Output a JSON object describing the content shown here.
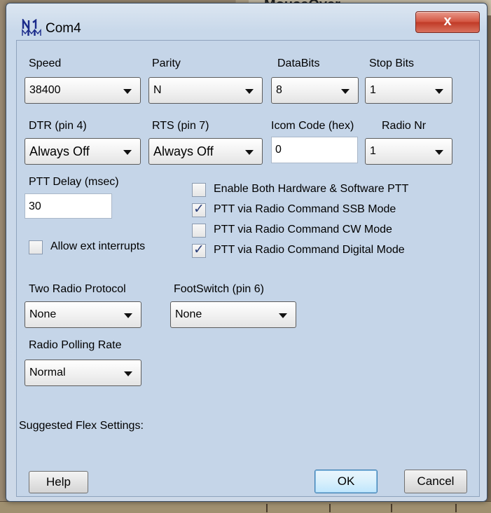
{
  "background": {
    "window_caption": "MouseOver"
  },
  "dialog": {
    "title": "Com4",
    "close_glyph": "x"
  },
  "labels": {
    "speed": "Speed",
    "parity": "Parity",
    "databits": "DataBits",
    "stopbits": "Stop Bits",
    "dtr": "DTR (pin 4)",
    "rts": "RTS (pin 7)",
    "icom": "Icom Code (hex)",
    "radio_nr": "Radio Nr",
    "ptt_delay": "PTT Delay  (msec)",
    "two_radio": "Two Radio Protocol",
    "footswitch": "FootSwitch (pin 6)",
    "polling": "Radio Polling Rate",
    "suggested": "Suggested Flex Settings:"
  },
  "fields": {
    "speed": "38400",
    "parity": "N",
    "databits": "8",
    "stopbits": "1",
    "dtr": "Always Off",
    "rts": "Always Off",
    "icom": "0",
    "radio_nr": "1",
    "ptt_delay": "30",
    "two_radio": "None",
    "footswitch": "None",
    "polling": "Normal"
  },
  "checkboxes": {
    "enable_both": {
      "label": "Enable Both Hardware & Software PTT",
      "checked": false
    },
    "ptt_ssb": {
      "label": "PTT via Radio Command SSB Mode",
      "checked": true
    },
    "ptt_cw": {
      "label": "PTT via Radio Command CW Mode",
      "checked": false
    },
    "ptt_digital": {
      "label": "PTT via Radio Command Digital Mode",
      "checked": true
    },
    "allow_ext": {
      "label": "Allow ext interrupts",
      "checked": false
    }
  },
  "buttons": {
    "help": "Help",
    "ok": "OK",
    "cancel": "Cancel"
  },
  "check_mark": "✓"
}
